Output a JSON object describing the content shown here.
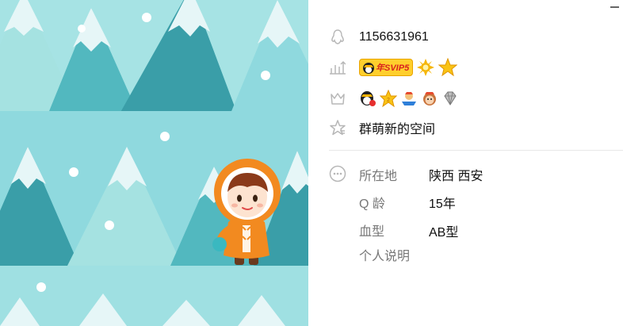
{
  "window": {
    "minimize_label": "minimize"
  },
  "profile": {
    "qq_number": "1156631961",
    "vip_badge_text": "年SVIP5",
    "signature": "群萌新的空间"
  },
  "details": {
    "location_label": "所在地",
    "location_value": "陕西 西安",
    "qage_label": "Q 龄",
    "qage_value": "15年",
    "blood_label": "血型",
    "blood_value": "AB型",
    "bio_label": "个人说明"
  },
  "icons": {
    "qq": "penguin-icon",
    "level": "level-bars-icon",
    "crown": "crown-icon",
    "star": "star-outline-icon",
    "more": "more-dots-icon"
  },
  "colors": {
    "bg_light": "#8fd9de",
    "tree_dark": "#3a9ea8",
    "tree_mid": "#52b8bf",
    "tree_light": "#a5e2e1",
    "snow": "#e6f6f7",
    "jacket": "#f28a20"
  }
}
